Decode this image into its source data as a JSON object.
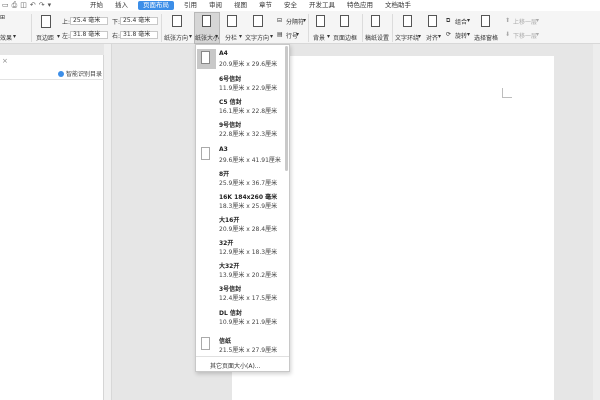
{
  "menubar": {
    "items": [
      "开始",
      "插入",
      "页面布局",
      "引用",
      "审阅",
      "视图",
      "章节",
      "安全",
      "开发工具",
      "特色应用",
      "文档助手"
    ],
    "active_index": 2
  },
  "ribbon": {
    "label_effect": "效果",
    "label_margin": "页边距",
    "top_label": "上:",
    "top_value": "25.4 毫米",
    "bottom_label": "下:",
    "bottom_value": "25.4 毫米",
    "left_label": "左:",
    "left_value": "31.8 毫米",
    "right_label": "右:",
    "right_value": "31.8 毫米",
    "orientation": "纸张方向",
    "paper_size": "纸张大小",
    "columns": "分栏",
    "text_direction": "文字方向",
    "breaks": "分隔符",
    "line_numbers": "行号",
    "background": "背景",
    "page_border": "页面边框",
    "draft_setup": "稿纸设置",
    "text_wrap": "文字环绕",
    "align": "对齐",
    "group": "组合",
    "rotate": "旋转",
    "selection_pane": "选择窗格",
    "bring_forward": "上移一层",
    "send_backward": "下移一层"
  },
  "left_panel": {
    "smart_toc": "智能识别目录"
  },
  "paper_sizes": [
    {
      "name": "A4",
      "size": "20.9厘米 x 29.6厘米",
      "selected": true
    },
    {
      "name": "6号信封",
      "size": "11.9厘米 x 22.9厘米",
      "selected": false
    },
    {
      "name": "C5 信封",
      "size": "16.1厘米 x 22.8厘米",
      "selected": false
    },
    {
      "name": "9号信封",
      "size": "22.8厘米 x 32.3厘米",
      "selected": false
    },
    {
      "name": "A3",
      "size": "29.6厘米 x 41.91厘米",
      "selected": false
    },
    {
      "name": "8开",
      "size": "25.9厘米 x 36.7厘米",
      "selected": false
    },
    {
      "name": "16K 184x260 毫米",
      "size": "18.3厘米 x 25.9厘米",
      "selected": false
    },
    {
      "name": "大16开",
      "size": "20.9厘米 x 28.4厘米",
      "selected": false
    },
    {
      "name": "32开",
      "size": "12.9厘米 x 18.3厘米",
      "selected": false
    },
    {
      "name": "大32开",
      "size": "13.9厘米 x 20.2厘米",
      "selected": false
    },
    {
      "name": "3号信封",
      "size": "12.4厘米 x 17.5厘米",
      "selected": false
    },
    {
      "name": "DL 信封",
      "size": "10.9厘米 x 21.9厘米",
      "selected": false
    },
    {
      "name": "信纸",
      "size": "21.5厘米 x 27.9厘米",
      "selected": false
    }
  ],
  "dropdown_footer": "其它页面大小(A)..."
}
